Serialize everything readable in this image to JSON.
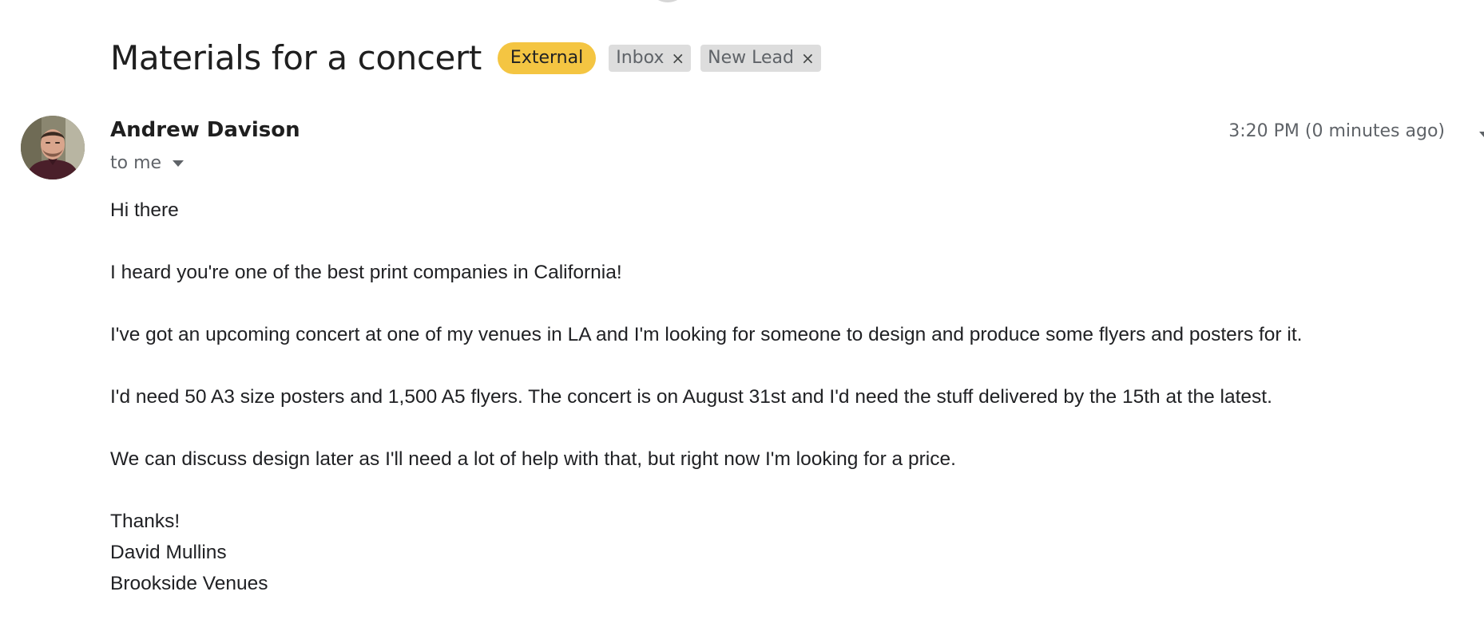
{
  "email": {
    "subject": "Materials for a concert",
    "labels": {
      "external": "External",
      "tags": [
        {
          "name": "Inbox",
          "remove": "×"
        },
        {
          "name": "New Lead",
          "remove": "×"
        }
      ]
    },
    "sender": {
      "name": "Andrew Davison",
      "recipient": "to me",
      "time": "3:20 PM (0 minutes ago)",
      "avatar": "sender-photo"
    },
    "body": {
      "greeting": "Hi there",
      "paragraphs": [
        "I heard you're one of the best print companies in California!",
        "I've got an upcoming concert at one of my venues in LA and I'm looking for someone to design and produce some flyers and posters for it.",
        "I'd need 50 A3 size posters and 1,500 A5 flyers. The concert is on August 31st and I'd need the stuff delivered by the 15th at the latest.",
        "We can discuss design later as I'll need a lot of help with that, but right now I'm looking for a price."
      ],
      "signoff": "Thanks!",
      "signature_name": "David Mullins",
      "signature_company": "Brookside Venues"
    },
    "colors": {
      "external_chip": "#f4c542",
      "label_chip": "#dddddd",
      "secondary_text": "#5f6368"
    }
  }
}
